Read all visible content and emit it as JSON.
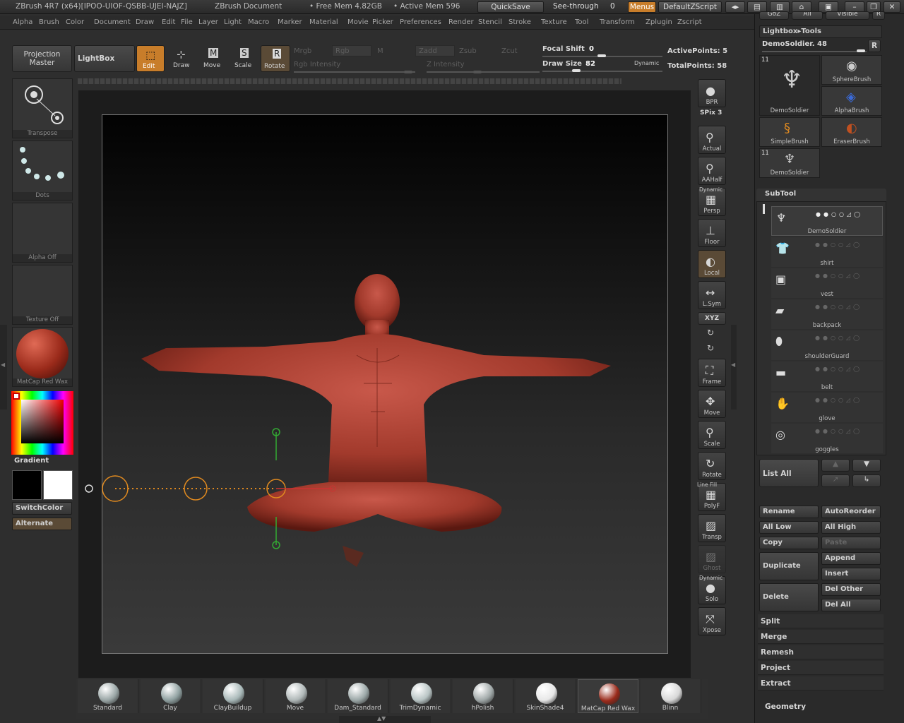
{
  "title_bar": {
    "app": "ZBrush 4R7 (x64)[IPOO-UIOF-QSBB-UJEI-NAJZ]",
    "document": "ZBrush Document",
    "free_mem": "• Free Mem 4.82GB",
    "active_mem": "• Active Mem 596",
    "quicksave": "QuickSave",
    "see_through_label": "See-through",
    "see_through_value": "0",
    "menus": "Menus",
    "default_zscript": "DefaultZScript"
  },
  "menu_bar": [
    "Alpha",
    "Brush",
    "Color",
    "Document",
    "Draw",
    "Edit",
    "File",
    "Layer",
    "Light",
    "Macro",
    "Marker",
    "Material",
    "Movie",
    "Picker",
    "Preferences",
    "Render",
    "Stencil",
    "Stroke",
    "Texture",
    "Tool",
    "Transform",
    "Zplugin",
    "Zscript"
  ],
  "top_shelf": {
    "projection_master": "Projection Master",
    "lightbox": "LightBox",
    "edit": "Edit",
    "draw": "Draw",
    "move": "Move",
    "scale": "Scale",
    "rotate": "Rotate",
    "mrgb": "Mrgb",
    "rgb": "Rgb",
    "m": "M",
    "rgb_intensity": "Rgb Intensity",
    "zadd": "Zadd",
    "zsub": "Zsub",
    "zcut": "Zcut",
    "z_intensity": "Z Intensity",
    "focal_shift_label": "Focal Shift",
    "focal_shift_value": "0",
    "draw_size_label": "Draw Size",
    "draw_size_value": "82",
    "dynamic": "Dynamic",
    "active_points": "ActivePoints: 5",
    "total_points": "TotalPoints: 58"
  },
  "left_shelf": {
    "transpose": "Transpose",
    "dots": "Dots",
    "alpha_off": "Alpha Off",
    "texture_off": "Texture Off",
    "matcap": "MatCap Red Wax",
    "gradient": "Gradient",
    "switchcolor": "SwitchColor",
    "alternate": "Alternate"
  },
  "right_shelf": [
    {
      "name": "bpr",
      "label": "BPR"
    },
    {
      "name": "spix",
      "label": "SPix 3"
    },
    {
      "name": "actual",
      "label": "Actual"
    },
    {
      "name": "aahalf",
      "label": "AAHalf"
    },
    {
      "name": "persp",
      "label": "Persp"
    },
    {
      "name": "floor",
      "label": "Floor"
    },
    {
      "name": "local",
      "label": "Local"
    },
    {
      "name": "lsym",
      "label": "L.Sym"
    },
    {
      "name": "xyz",
      "label": "XYZ"
    },
    {
      "name": "frame",
      "label": "Frame"
    },
    {
      "name": "move",
      "label": "Move"
    },
    {
      "name": "scale",
      "label": "Scale"
    },
    {
      "name": "rotate",
      "label": "Rotate"
    },
    {
      "name": "polyf",
      "label": "PolyF"
    },
    {
      "name": "transp",
      "label": "Transp"
    },
    {
      "name": "ghost",
      "label": "Ghost"
    },
    {
      "name": "solo",
      "label": "Solo"
    },
    {
      "name": "xpose",
      "label": "Xpose"
    }
  ],
  "right_shelf_extra": {
    "dynamic": "Dynamic",
    "line_fill": "Line Fill"
  },
  "tool_panel": {
    "header_buttons": [
      "GoZ",
      "All",
      "Visible",
      "R"
    ],
    "lightbox_tools": "Lightbox▸Tools",
    "current_tool": "DemoSoldier. 48",
    "r_label": "R",
    "tools": [
      {
        "label": "DemoSoldier",
        "count": "11"
      },
      {
        "label": "SphereBrush"
      },
      {
        "label": "AlphaBrush"
      },
      {
        "label": "SimpleBrush"
      },
      {
        "label": "EraserBrush"
      },
      {
        "label": "DemoSoldier",
        "count": "11"
      }
    ]
  },
  "subtool": {
    "title": "SubTool",
    "items": [
      "DemoSoldier",
      "shirt",
      "vest",
      "backpack",
      "shoulderGuard",
      "belt",
      "glove",
      "goggles"
    ],
    "list_all": "List All",
    "rename": "Rename",
    "autoreorder": "AutoReorder",
    "all_low": "All Low",
    "all_high": "All High",
    "copy": "Copy",
    "paste": "Paste",
    "duplicate": "Duplicate",
    "append": "Append",
    "insert": "Insert",
    "delete": "Delete",
    "del_other": "Del Other",
    "del_all": "Del All",
    "split": "Split",
    "merge": "Merge",
    "remesh": "Remesh",
    "project": "Project",
    "extract": "Extract",
    "geometry": "Geometry"
  },
  "bottom_materials": [
    {
      "label": "Standard",
      "color": "#9aa6a6"
    },
    {
      "label": "Clay",
      "color": "#8fa0a0"
    },
    {
      "label": "ClayBuildup",
      "color": "#a8b8b8"
    },
    {
      "label": "Move",
      "color": "#b0b8b8"
    },
    {
      "label": "Dam_Standard",
      "color": "#9ca8a8"
    },
    {
      "label": "TrimDynamic",
      "color": "#b8c4c4"
    },
    {
      "label": "hPolish",
      "color": "#a0a8a8"
    },
    {
      "label": "SkinShade4",
      "color": "#e8e8e8"
    },
    {
      "label": "MatCap Red Wax",
      "color": "#9a2a1a"
    },
    {
      "label": "Blinn",
      "color": "#d8d8d8"
    }
  ]
}
